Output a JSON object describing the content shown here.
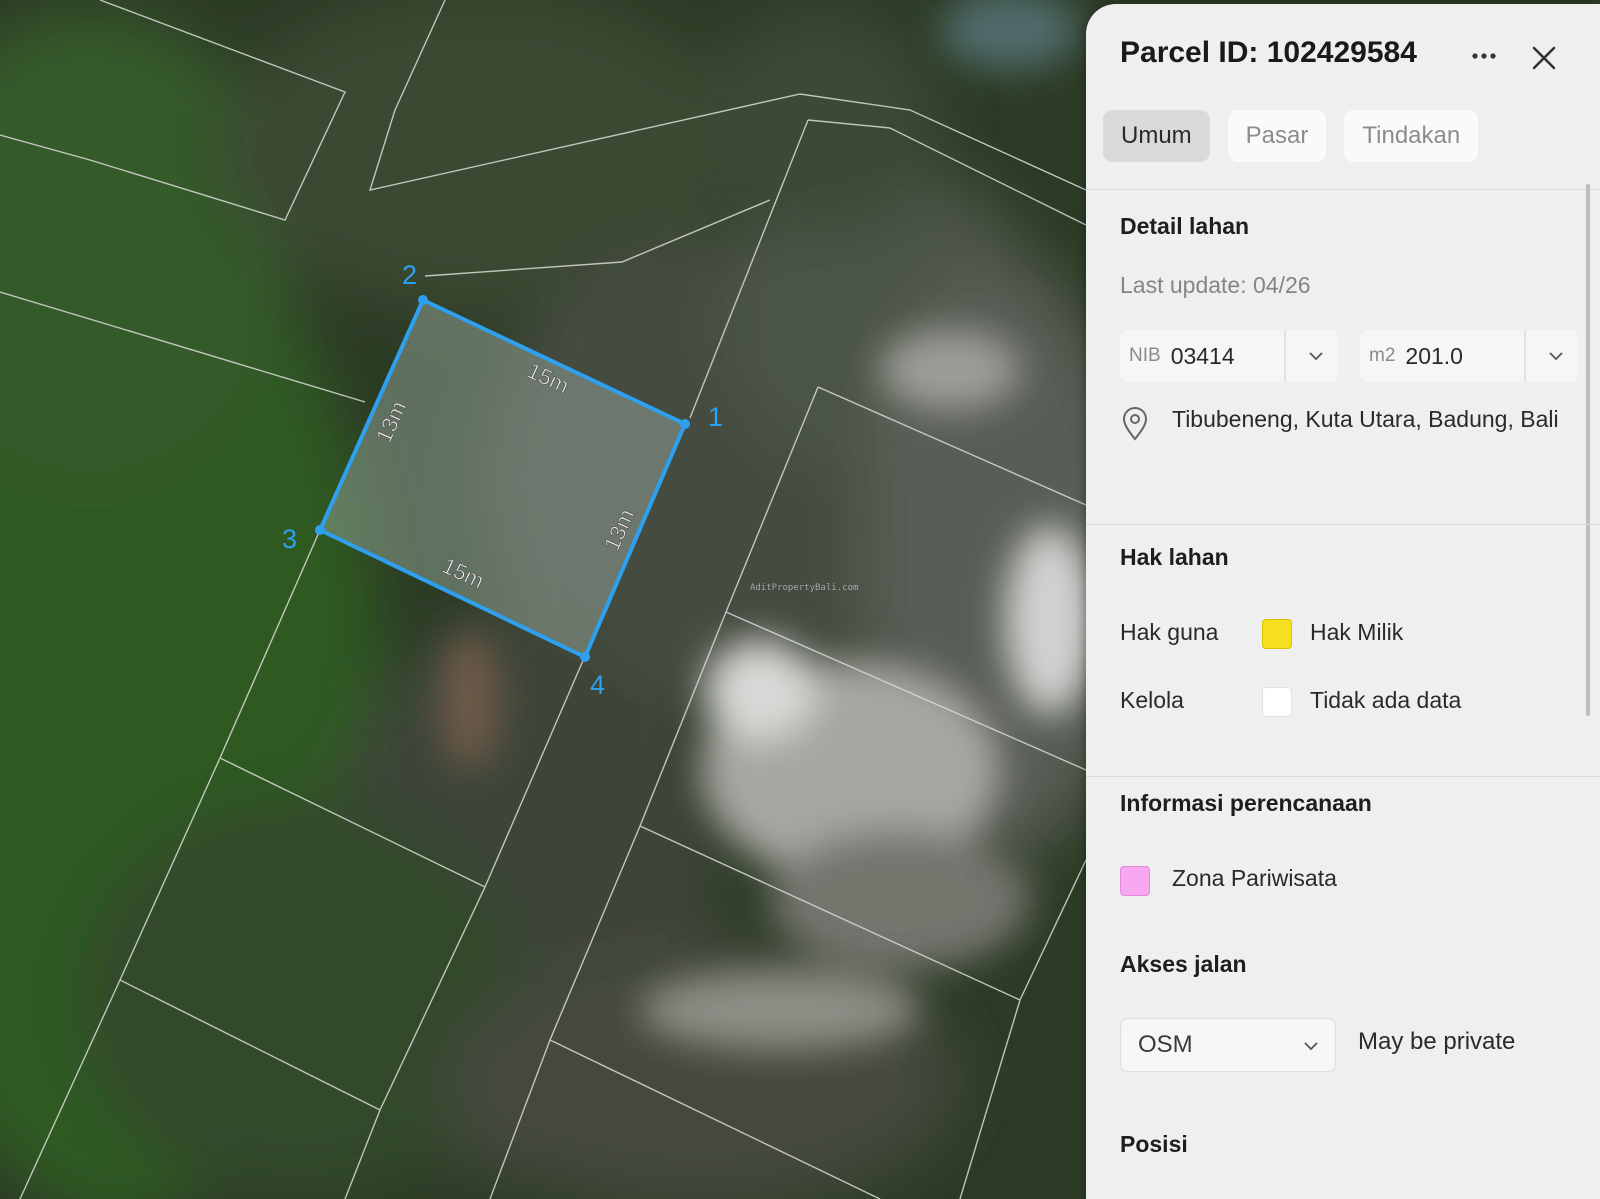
{
  "map": {
    "watermark": "AditPropertyBali.com",
    "vertex_labels": [
      "1",
      "2",
      "3",
      "4"
    ],
    "edge_labels": {
      "top": "15m",
      "bottom": "15m",
      "left": "13m",
      "right": "13m"
    },
    "highlight_color": "#2ea0f0"
  },
  "panel": {
    "title": "Parcel ID: 102429584",
    "more_icon": "more-horizontal-icon",
    "close_icon": "close-icon",
    "tabs": [
      {
        "label": "Umum",
        "active": true
      },
      {
        "label": "Pasar",
        "active": false
      },
      {
        "label": "Tindakan",
        "active": false
      }
    ],
    "detail": {
      "title": "Detail lahan",
      "last_update": "Last update: 04/26",
      "nib_label": "NIB",
      "nib_value": "03414",
      "area_label": "m2",
      "area_value": "201.0",
      "address": "Tibubeneng, Kuta Utara, Badung, Bali"
    },
    "rights": {
      "title": "Hak lahan",
      "rows": [
        {
          "label": "Hak guna",
          "value": "Hak Milik",
          "color": "#f5df1e"
        },
        {
          "label": "Kelola",
          "value": "Tidak ada data",
          "color": "#ffffff"
        }
      ]
    },
    "planning": {
      "title": "Informasi perencanaan",
      "zone": "Zona Pariwisata",
      "zone_color": "#f7a8f0"
    },
    "road": {
      "title": "Akses jalan",
      "source": "OSM",
      "note": "May be private"
    },
    "position": {
      "title": "Posisi"
    }
  }
}
